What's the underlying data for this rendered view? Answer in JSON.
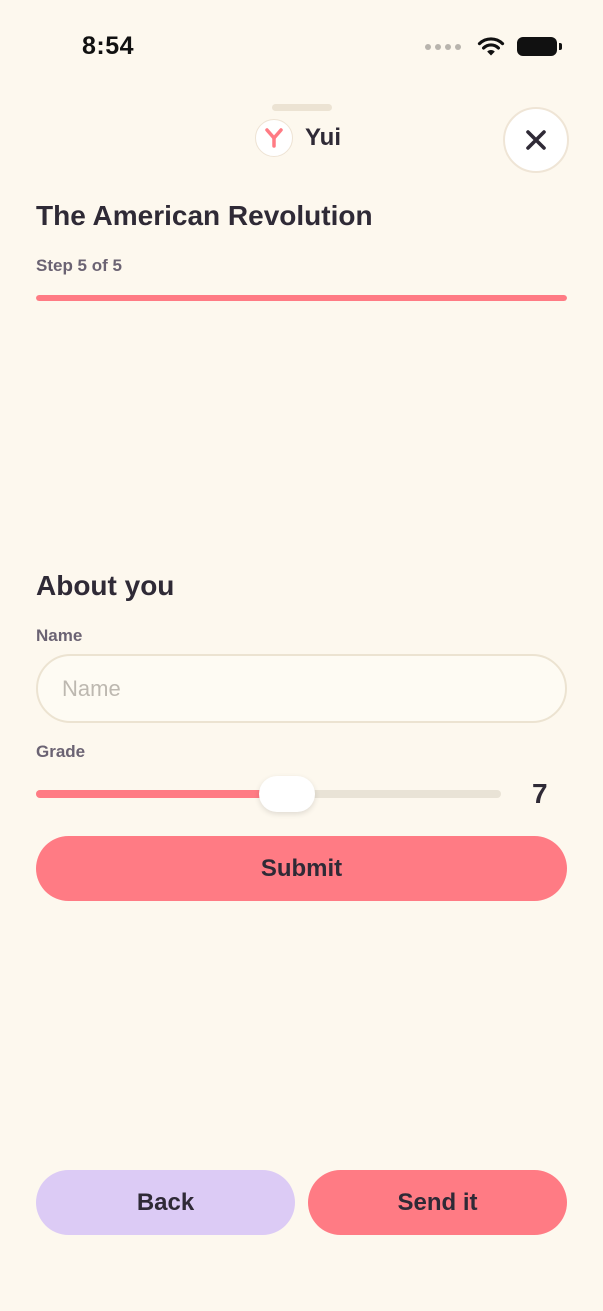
{
  "status_bar": {
    "time": "8:54"
  },
  "header": {
    "brand_name": "Yui",
    "logo_letter": "Y",
    "accent_color": "#ff7b84"
  },
  "form": {
    "title": "The American Revolution",
    "step_label": "Step 5 of 5",
    "progress": 1.0,
    "section_title": "About you",
    "name_label": "Name",
    "name_placeholder": "Name",
    "name_value": "",
    "grade_label": "Grade",
    "grade_value": "7",
    "grade_slider_fraction": 0.54,
    "submit_label": "Submit"
  },
  "footer": {
    "back_label": "Back",
    "send_label": "Send it"
  },
  "colors": {
    "background": "#fdf8ee",
    "accent": "#ff7b84",
    "back_button": "#dccbf5",
    "text": "#2f2a36"
  }
}
